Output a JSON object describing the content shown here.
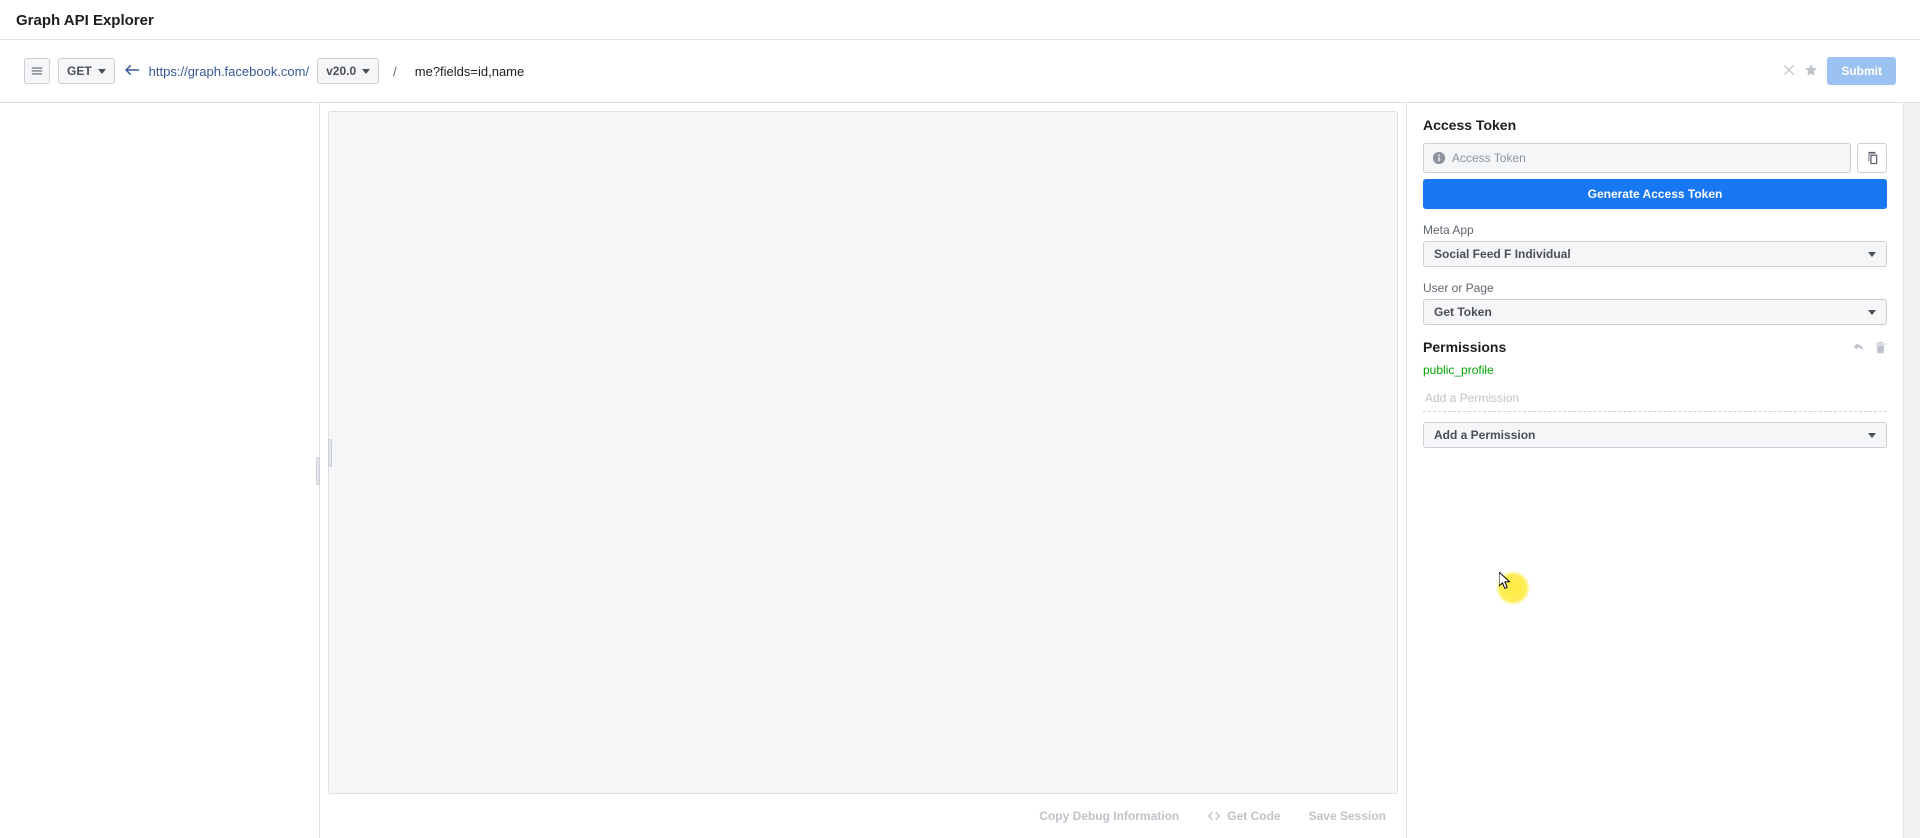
{
  "header": {
    "title": "Graph API Explorer"
  },
  "requestBar": {
    "method": "GET",
    "baseUrl": "https://graph.facebook.com/",
    "version": "v20.0",
    "slash": "/",
    "path": "me?fields=id,name",
    "submit": "Submit"
  },
  "footer": {
    "copyDebug": "Copy Debug Information",
    "getCode": "Get Code",
    "saveSession": "Save Session"
  },
  "side": {
    "accessToken": {
      "title": "Access Token",
      "placeholder": "Access Token",
      "generate": "Generate Access Token"
    },
    "metaApp": {
      "label": "Meta App",
      "selected": "Social Feed F Individual"
    },
    "userOrPage": {
      "label": "User or Page",
      "selected": "Get Token"
    },
    "permissions": {
      "title": "Permissions",
      "items": [
        "public_profile"
      ],
      "addPlaceholder": "Add a Permission",
      "addLabel": "Add a Permission"
    }
  }
}
